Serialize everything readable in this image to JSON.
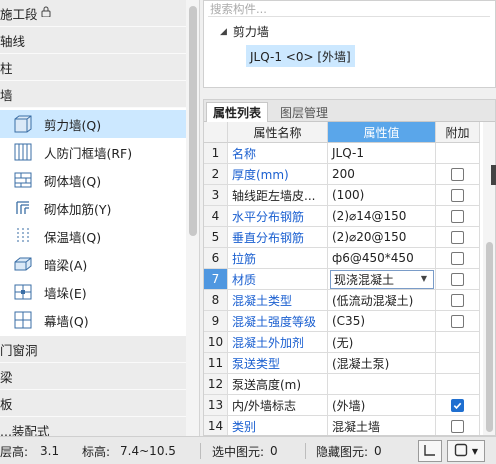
{
  "left_panel": {
    "categories": [
      {
        "label": "施工段",
        "has_lock": true
      },
      {
        "label": "轴线"
      },
      {
        "label": "柱"
      },
      {
        "label": "墙"
      }
    ],
    "wall_items": [
      {
        "label": "剪力墙(Q)",
        "icon": "shear-wall-icon",
        "selected": true
      },
      {
        "label": "人防门框墙(RF)",
        "icon": "civil-defense-door-frame-wall-icon"
      },
      {
        "label": "砌体墙(Q)",
        "icon": "masonry-wall-icon"
      },
      {
        "label": "砌体加筋(Y)",
        "icon": "masonry-reinforcement-icon"
      },
      {
        "label": "保温墙(Q)",
        "icon": "insulation-wall-icon"
      },
      {
        "label": "暗梁(A)",
        "icon": "hidden-beam-icon"
      },
      {
        "label": "墙垛(E)",
        "icon": "wall-pier-icon"
      },
      {
        "label": "幕墙(Q)",
        "icon": "curtain-wall-icon"
      }
    ],
    "bottom_categories": [
      {
        "label": "门窗洞"
      },
      {
        "label": "梁"
      },
      {
        "label": "板"
      },
      {
        "label": "...装配式"
      }
    ]
  },
  "search": {
    "placeholder": "搜索构件...",
    "type_node": "剪力墙",
    "child_node": "JLQ-1 <0> [外墙]"
  },
  "properties": {
    "tabs": [
      "属性列表",
      "图层管理"
    ],
    "headers": {
      "name": "属性名称",
      "value": "属性值",
      "extra": "附加"
    },
    "rows": [
      {
        "num": "1",
        "name": "名称",
        "value": "JLQ-1",
        "blue": true,
        "checkbox": "none"
      },
      {
        "num": "2",
        "name": "厚度(mm)",
        "value": "200",
        "blue": true,
        "checkbox": "off"
      },
      {
        "num": "3",
        "name": "轴线距左墙皮...",
        "value": "(100)",
        "blue": false,
        "checkbox": "off"
      },
      {
        "num": "4",
        "name": "水平分布钢筋",
        "value": "(2)⌀14@150",
        "blue": true,
        "checkbox": "off"
      },
      {
        "num": "5",
        "name": "垂直分布钢筋",
        "value": "(2)⌀20@150",
        "blue": true,
        "checkbox": "off"
      },
      {
        "num": "6",
        "name": "拉筋",
        "value": "ф6@450*450",
        "blue": true,
        "checkbox": "off"
      },
      {
        "num": "7",
        "name": "材质",
        "value": "现浇混凝土",
        "blue": true,
        "checkbox": "off",
        "selected": true,
        "combo": true
      },
      {
        "num": "8",
        "name": "混凝土类型",
        "value": "(低流动混凝土)",
        "blue": true,
        "checkbox": "off"
      },
      {
        "num": "9",
        "name": "混凝土强度等级",
        "value": "(C35)",
        "blue": true,
        "checkbox": "off"
      },
      {
        "num": "10",
        "name": "混凝土外加剂",
        "value": "(无)",
        "blue": true,
        "checkbox": "none"
      },
      {
        "num": "11",
        "name": "泵送类型",
        "value": "(混凝土泵)",
        "blue": true,
        "checkbox": "none"
      },
      {
        "num": "12",
        "name": "泵送高度(m)",
        "value": "",
        "blue": false,
        "checkbox": "none"
      },
      {
        "num": "13",
        "name": "内/外墙标志",
        "value": "(外墙)",
        "blue": false,
        "checkbox": "on"
      },
      {
        "num": "14",
        "name": "类别",
        "value": "混凝土墙",
        "blue": true,
        "checkbox": "off"
      }
    ]
  },
  "status_bar": {
    "floor_height_label": "层高:",
    "floor_height_value": "3.1",
    "elevation_label": "标高:",
    "elevation_value": "7.4~10.5",
    "selected_label": "选中图元:",
    "selected_value": "0",
    "hidden_label": "隐藏图元:",
    "hidden_value": "0"
  }
}
